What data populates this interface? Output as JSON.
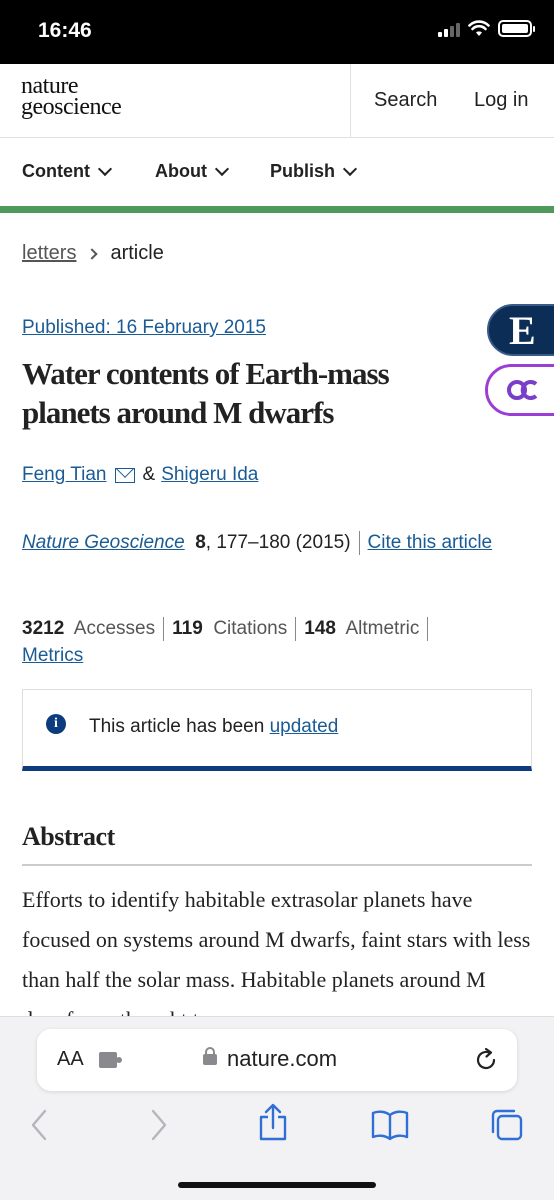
{
  "status": {
    "time": "16:46"
  },
  "header": {
    "logo_line1": "nature",
    "logo_line2": "geoscience",
    "search": "Search",
    "login": "Log in"
  },
  "nav": {
    "items": [
      {
        "label": "Content"
      },
      {
        "label": "About"
      },
      {
        "label": "Publish"
      }
    ]
  },
  "breadcrumb": {
    "parent": "letters",
    "current": "article"
  },
  "badges": {
    "e": "E"
  },
  "article": {
    "published": "Published: 16 February 2015",
    "title": "Water contents of Earth-mass planets around M dwarfs",
    "authors": [
      "Feng Tian",
      "Shigeru Ida"
    ],
    "author_sep": "&",
    "journal": "Nature Geoscience",
    "volume": "8",
    "pages": ", 177–180 (2015)",
    "cite": "Cite this article"
  },
  "metrics": {
    "accesses_value": "3212",
    "accesses_label": "Accesses",
    "citations_value": "119",
    "citations_label": "Citations",
    "altmetric_value": "148",
    "altmetric_label": "Altmetric",
    "metrics_link": "Metrics"
  },
  "notice": {
    "icon": "i",
    "text": "This article has been ",
    "link": "updated"
  },
  "abstract": {
    "heading": "Abstract",
    "text": "Efforts to identify habitable extrasolar planets have focused on systems around M dwarfs, faint stars with less than half the solar mass. Habitable planets around M dwarfs are thought to"
  },
  "browser": {
    "aa": "AA",
    "domain": "nature.com"
  }
}
